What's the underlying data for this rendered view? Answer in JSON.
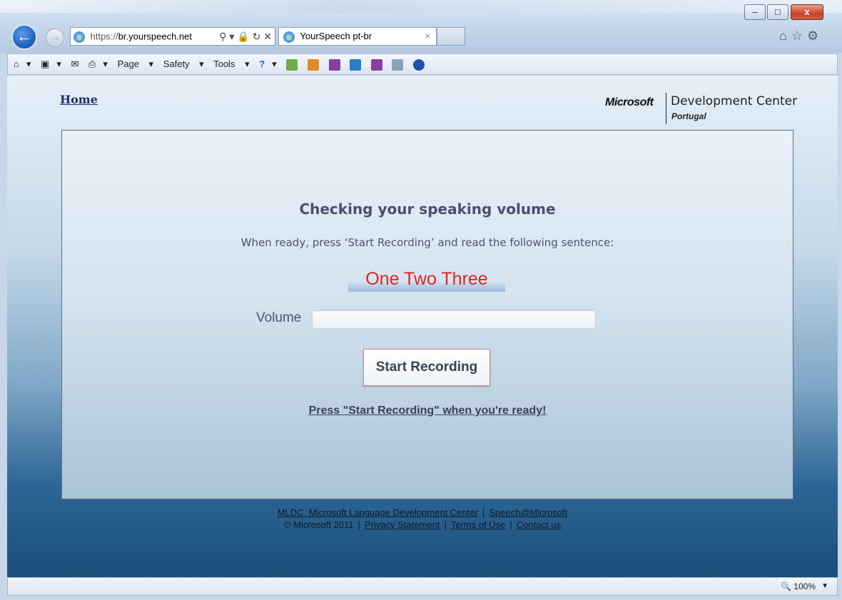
{
  "window": {
    "minimize_glyph": "–",
    "maximize_glyph": "□",
    "close_glyph": "x"
  },
  "browser": {
    "back_glyph": "←",
    "forward_glyph": "→",
    "address_proto": "https://",
    "address_host": "br.yourspeech.net",
    "address_tools": "⚲ ▾ 🔒 ↻ ✕",
    "tab_title": "YourSpeech pt-br",
    "tab_close": "×",
    "right_icons": "⌂☆⚙",
    "command_bar": {
      "home_menu": "▾",
      "feeds_menu": "▾",
      "print_menu": "▾",
      "page": "Page",
      "safety": "Safety",
      "tools": "Tools",
      "help": "▾"
    },
    "zoom": "100%",
    "zoom_arrow": "▼"
  },
  "header": {
    "home_link": "Home",
    "brand_microsoft": "Microsoft",
    "brand_center": "Development Center",
    "brand_country": "Portugal"
  },
  "main": {
    "title": "Checking your speaking volume",
    "instruction": "When ready, press ‘Start Recording’ and read the following sentence:",
    "sentence": "One Two Three",
    "volume_label": "Volume",
    "volume_level": 0,
    "start_button": "Start Recording",
    "hint": "Press \"Start Recording\" when you're ready!"
  },
  "footer": {
    "mldc_link": "MLDC, Microsoft Language Development Center",
    "separator": "|",
    "speech_link": "Speech@Microsoft",
    "copyright": "© Microsoft 2011",
    "privacy_link": "Privacy Statement",
    "terms_link": "Terms of Use",
    "contact_link": "Contact us"
  },
  "colors": {
    "accent_red": "#e02424",
    "link_navy": "#1d2f6e",
    "page_bottom": "#1c4f7a"
  }
}
